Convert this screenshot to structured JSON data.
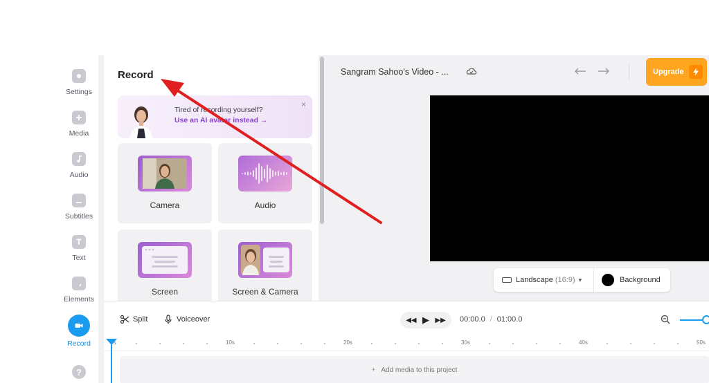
{
  "sidebar": {
    "items": [
      {
        "label": "Settings",
        "icon": "settings-icon"
      },
      {
        "label": "Media",
        "icon": "plus-icon"
      },
      {
        "label": "Audio",
        "icon": "music-note-icon"
      },
      {
        "label": "Subtitles",
        "icon": "subtitles-icon"
      },
      {
        "label": "Text",
        "icon": "text-t-icon"
      },
      {
        "label": "Elements",
        "icon": "elements-icon"
      },
      {
        "label": "Record",
        "icon": "video-camera-icon",
        "active": true
      }
    ],
    "help_glyph": "?",
    "active_color": "#1a9bf0"
  },
  "record_panel": {
    "title": "Record",
    "promo": {
      "line1": "Tired of recording yourself?",
      "line2": "Use an AI avatar instead →",
      "close": "×"
    },
    "options": [
      {
        "label": "Camera"
      },
      {
        "label": "Audio"
      },
      {
        "label": "Screen"
      },
      {
        "label": "Screen & Camera"
      }
    ]
  },
  "editor": {
    "project_title": "Sangram Sahoo's Video - ...",
    "upgrade_label": "Upgrade",
    "upgrade_color": "#ffa51f",
    "canvas_color": "#000000",
    "aspect": {
      "label": "Landscape",
      "ratio": "(16:9)"
    },
    "background_label": "Background"
  },
  "timeline": {
    "split_label": "Split",
    "voiceover_label": "Voiceover",
    "current_time": "00:00.0",
    "time_separator": "/",
    "total_time": "01:00.0",
    "ruler_labels": [
      "0s",
      "10s",
      "20s",
      "30s",
      "40s",
      "50s"
    ],
    "add_media_label": "Add media to this project",
    "add_media_plus": "+"
  },
  "annotation": {
    "color": "#e02020"
  }
}
